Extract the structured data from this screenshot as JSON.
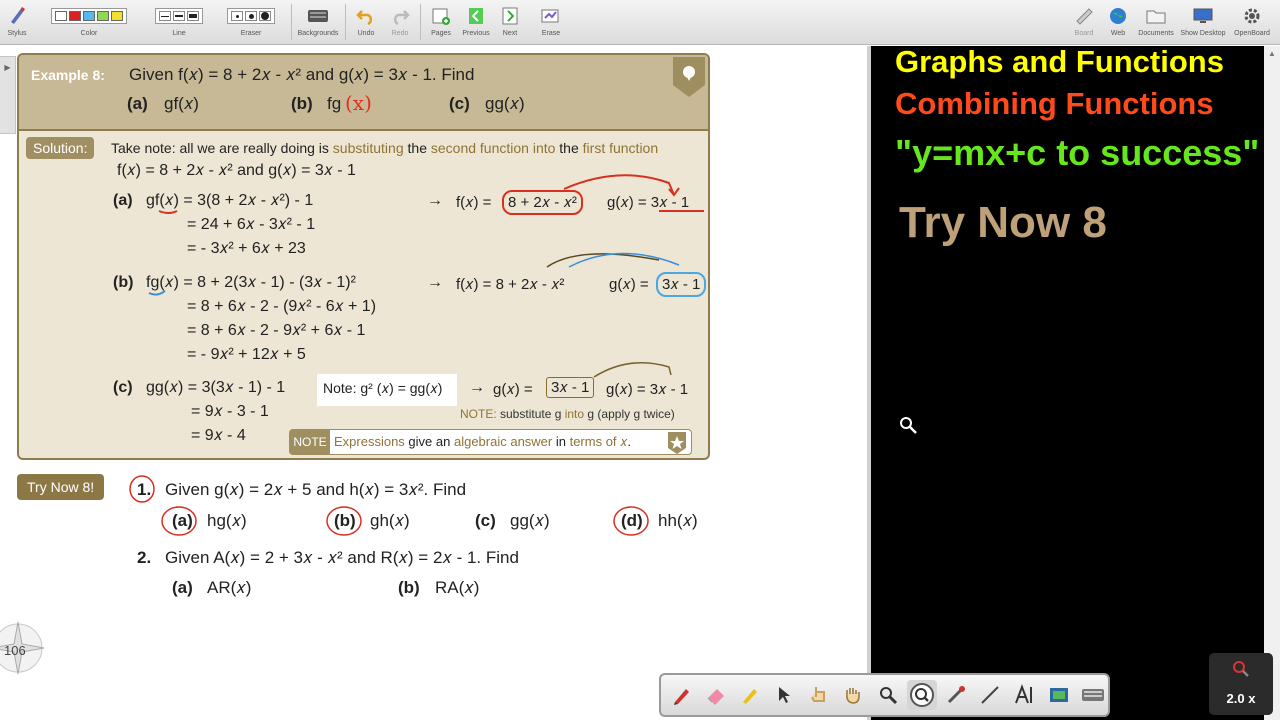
{
  "toolbar": {
    "stylus": "Stylus",
    "color": "Color",
    "line": "Line",
    "eraser": "Eraser",
    "backgrounds": "Backgrounds",
    "undo": "Undo",
    "redo": "Redo",
    "pages": "Pages",
    "previous": "Previous",
    "next": "Next",
    "erase": "Erase",
    "board": "Board",
    "web": "Web",
    "documents": "Documents",
    "show_desktop": "Show Desktop",
    "openboard": "OpenBoard",
    "colors": [
      "#ffffff",
      "#e02020",
      "#55b8f0",
      "#8fd84f",
      "#f2e02a"
    ]
  },
  "example": {
    "badge": "Example 8:",
    "given": "Given  f(𝑥) = 8 + 2𝑥 - 𝑥²  and  g(𝑥) = 3𝑥 - 1.  Find",
    "part_a_label": "(a)",
    "part_a": "gf(𝑥)",
    "part_b_label": "(b)",
    "part_b": "fg",
    "part_b_hand": "(x)",
    "part_c_label": "(c)",
    "part_c": "gg(𝑥)",
    "solution_badge": "Solution:",
    "note_pre1": "Take note: all we are really doing is ",
    "note_hl1": "substituting",
    "note_mid1": " the ",
    "note_hl2": "second function into",
    "note_mid2": " the ",
    "note_hl3": "first function",
    "functions": "f(𝑥) = 8 + 2𝑥 - 𝑥²   and  g(𝑥) = 3𝑥 - 1",
    "a_label": "(a)",
    "a_line1": "gf(𝑥) = 3(8 + 2𝑥 - 𝑥²) - 1",
    "a_line2": "= 24 + 6𝑥 - 3𝑥² - 1",
    "a_line3": "= - 3𝑥² + 6𝑥 + 23",
    "a_side_arrow": "→",
    "a_side_f": "f(𝑥) =",
    "a_side_f_box": "8 + 2𝑥 - 𝑥²",
    "a_side_g": "g(𝑥) = 3𝑥 - 1",
    "b_label": "(b)",
    "b_line1": "fg(𝑥) = 8 + 2(3𝑥 - 1) - (3𝑥 - 1)²",
    "b_line2": "= 8 + 6𝑥 - 2 - (9𝑥² - 6𝑥 + 1)",
    "b_line3": "= 8 + 6𝑥 - 2 - 9𝑥² + 6𝑥 - 1",
    "b_line4": "= - 9𝑥² + 12𝑥 + 5",
    "b_side_arrow": "→",
    "b_side_f": "f(𝑥) = 8 + 2𝑥 - 𝑥²",
    "b_side_g": "g(𝑥) =",
    "b_side_g_box": "3𝑥 - 1",
    "c_label": "(c)",
    "c_line1": "gg(𝑥) = 3(3𝑥 - 1) - 1",
    "c_line2": "=  9𝑥 - 3 - 1",
    "c_line3": "=  9𝑥 - 4",
    "c_note": "Note: g² (𝑥) = gg(𝑥)",
    "c_side_arrow": "→",
    "c_side_g": "g(𝑥) =",
    "c_side_g_box": "3𝑥 - 1",
    "c_side_g2": "g(𝑥) = 3𝑥 - 1",
    "c_note2_pre": "NOTE:",
    "c_note2_rest": " substitute g ",
    "c_note2_into": "into",
    "c_note2_end": " g (apply g twice)",
    "notebar_tag": "NOTE",
    "notebar_pre": "Expressions",
    "notebar_mid": " give an ",
    "notebar_hl": "algebraic answer",
    "notebar_mid2": " in ",
    "notebar_hl2": "terms of 𝑥",
    "notebar_end": "."
  },
  "try_now": {
    "label": "Try Now 8!",
    "q1_num": "1.",
    "q1_text": "Given  g(𝑥) = 2𝑥 + 5  and  h(𝑥) = 3𝑥².  Find",
    "q1_a_label": "(a)",
    "q1_a": "hg(𝑥)",
    "q1_b_label": "(b)",
    "q1_b": "gh(𝑥)",
    "q1_c_label": "(c)",
    "q1_c": "gg(𝑥)",
    "q1_d_label": "(d)",
    "q1_d": "hh(𝑥)",
    "q2_num": "2.",
    "q2_text": "Given  A(𝑥) = 2 + 3𝑥 - 𝑥²  and  R(𝑥) = 2𝑥 - 1.  Find",
    "q2_a_label": "(a)",
    "q2_a": "AR(𝑥)",
    "q2_b_label": "(b)",
    "q2_b": "RA(𝑥)"
  },
  "page_number": "106",
  "board": {
    "title1": "Graphs and Functions",
    "title2": "Combining Functions",
    "title3": "\"y=mx+c to success\"",
    "title4": "Try Now 8"
  },
  "zoom": {
    "label": "2.0 x"
  },
  "palette_tools": [
    "pen-icon",
    "eraser-icon",
    "highlighter-icon",
    "pointer-icon",
    "interact-hand-icon",
    "pan-hand-icon",
    "zoom-in-icon",
    "zoom-out-icon",
    "laser-icon",
    "line-icon",
    "text-icon",
    "capture-icon",
    "keyboard-icon"
  ]
}
